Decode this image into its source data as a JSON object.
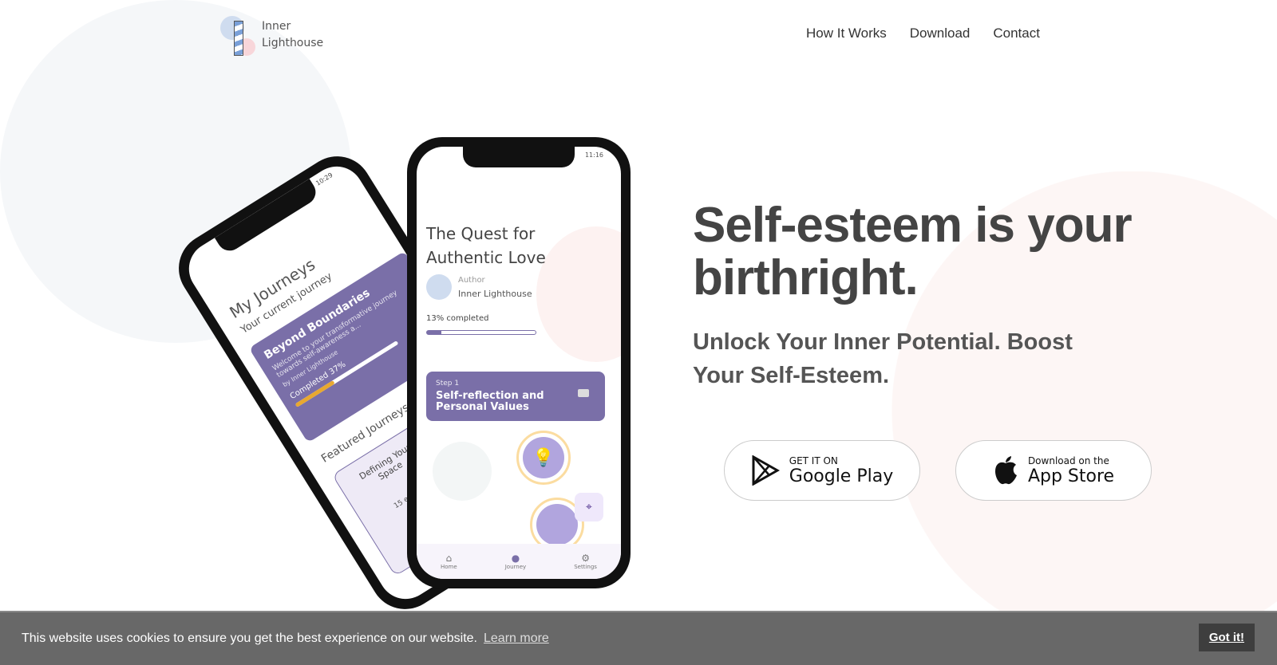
{
  "brand": {
    "line1": "Inner",
    "line2": "Lighthouse"
  },
  "nav": [
    "How It Works",
    "Download",
    "Contact"
  ],
  "hero": {
    "title_line1": "Self-esteem is your",
    "title_line2": "birthright.",
    "subtitle": "Unlock Your Inner Potential. Boost Your Self-Esteem."
  },
  "stores": {
    "google": {
      "small": "GET IT ON",
      "big": "Google Play",
      "icon": "google-play-icon"
    },
    "apple": {
      "small": "Download on the",
      "big": "App Store",
      "icon": "apple-icon"
    }
  },
  "phone_left": {
    "time": "10:29",
    "title": "My Journeys",
    "subtitle": "Your current journey",
    "card_title": "Beyond Boundaries",
    "card_desc": "Welcome to your transformative journey towards self-awareness a...",
    "card_by": "by Inner Lighthouse",
    "completed": "Completed 37%",
    "progress": 37,
    "featured": "Featured Journeys",
    "featured_card": "Defining Your Space",
    "featured_meta": "15 exe..."
  },
  "phone_right": {
    "time": "11:16",
    "title_line1": "The Quest for",
    "title_line2": "Authentic Love",
    "author_label": "Author",
    "author": "Inner Lighthouse",
    "completed": "13% completed",
    "progress": 13,
    "step_label": "Step 1",
    "step_title": "Self-reflection and Personal Values",
    "tabs": [
      "Home",
      "Journey",
      "Settings"
    ]
  },
  "cookie": {
    "text": "This website uses cookies to ensure you get the best experience on our website.",
    "link": "Learn more",
    "button": "Got it!"
  },
  "colors": {
    "accent": "#7a6fa8",
    "cookie_bg": "#686868",
    "button_bg": "#3e3e3e",
    "progress_left": "#e8a830"
  }
}
